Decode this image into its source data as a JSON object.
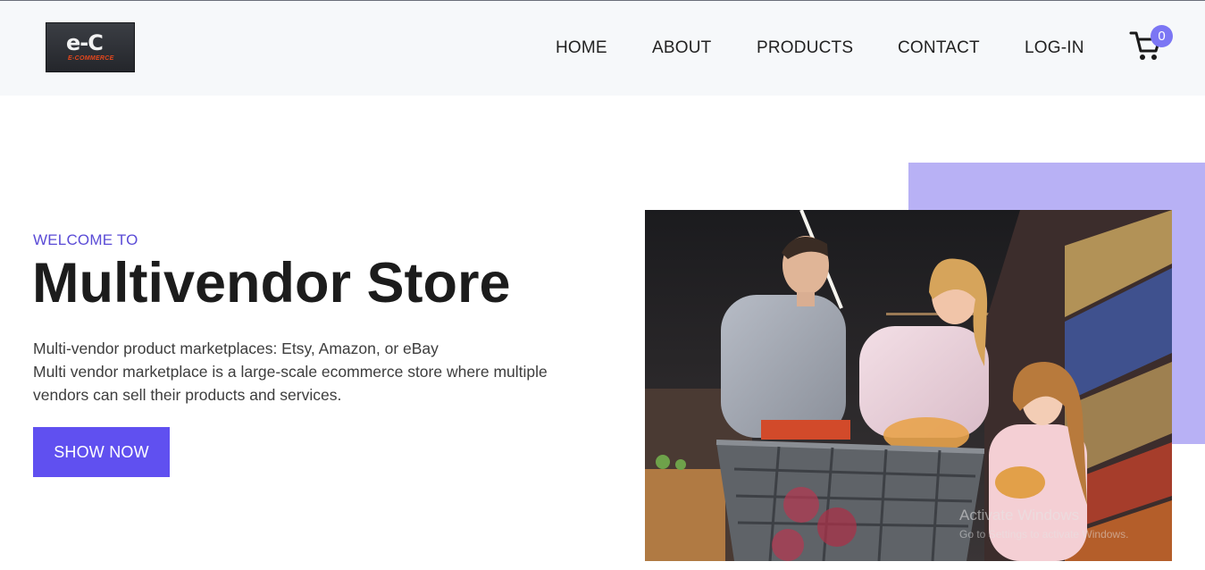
{
  "header": {
    "logo": {
      "mark": "e-C",
      "subtitle": "E-COMMERCE"
    },
    "nav": [
      "HOME",
      "ABOUT",
      "PRODUCTS",
      "CONTACT",
      "LOG-IN"
    ],
    "cart": {
      "icon": "cart-icon",
      "count": "0"
    }
  },
  "hero": {
    "eyebrow": "WELCOME TO",
    "title": "Multivendor Store",
    "description": [
      "Multi-vendor product marketplaces: Etsy, Amazon, or eBay",
      "Multi vendor marketplace is a large-scale ecommerce store where multiple",
      "vendors can sell their products and services."
    ],
    "cta_label": "SHOW NOW"
  },
  "overlay": {
    "activation_title": "Activate Windows",
    "activation_hint": "Go to Settings to activate Windows."
  },
  "colors": {
    "accent": "#6050f0",
    "accent_light": "#b8b1f5",
    "header_bg": "#f6f8fa",
    "badge": "#7b76f4"
  }
}
